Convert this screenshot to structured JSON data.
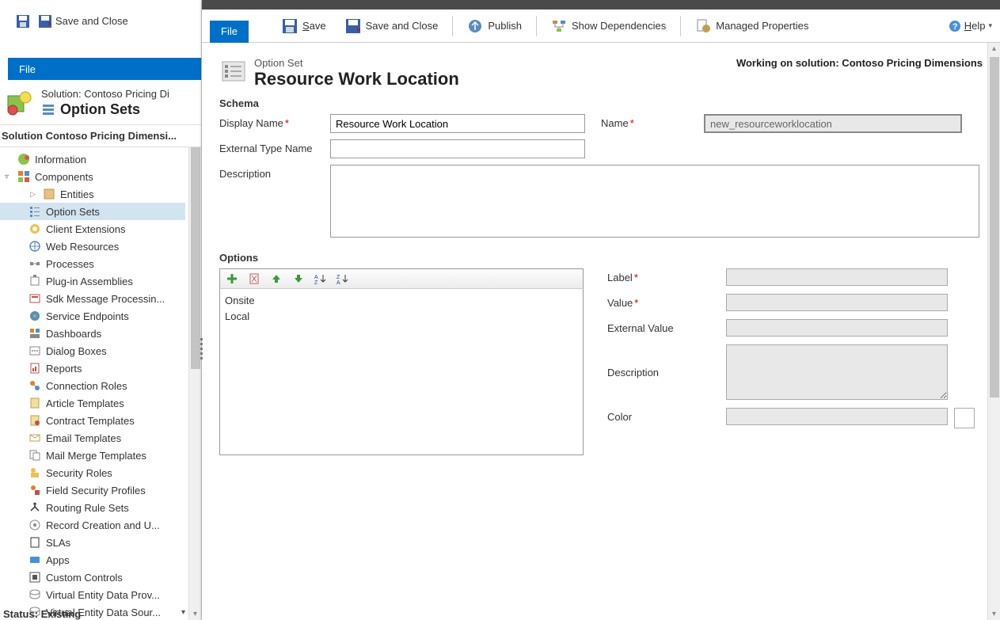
{
  "left": {
    "file_label": "File",
    "toolbar": {
      "save_close": "Save and Close"
    },
    "solution_label": "Solution: Contoso Pricing Di",
    "solution_title": "Option Sets",
    "section_title": "Solution Contoso Pricing Dimensi...",
    "tree": {
      "information": "Information",
      "components": "Components",
      "entities": "Entities",
      "option_sets": "Option Sets",
      "client_extensions": "Client Extensions",
      "web_resources": "Web Resources",
      "processes": "Processes",
      "plugin_assemblies": "Plug-in Assemblies",
      "sdk_message": "Sdk Message Processin...",
      "service_endpoints": "Service Endpoints",
      "dashboards": "Dashboards",
      "dialog_boxes": "Dialog Boxes",
      "reports": "Reports",
      "connection_roles": "Connection Roles",
      "article_templates": "Article Templates",
      "contract_templates": "Contract Templates",
      "email_templates": "Email Templates",
      "mail_merge": "Mail Merge Templates",
      "security_roles": "Security Roles",
      "field_security": "Field Security Profiles",
      "routing_rule": "Routing Rule Sets",
      "record_creation": "Record Creation and U...",
      "slas": "SLAs",
      "apps": "Apps",
      "custom_controls": "Custom Controls",
      "virtual_entity_prov": "Virtual Entity Data Prov...",
      "virtual_entity_sour": "Virtual Entity Data Sour..."
    },
    "status": "Status: Existing"
  },
  "right": {
    "file_label": "File",
    "ribbon": {
      "save": "Save",
      "save_close": "Save and Close",
      "publish": "Publish",
      "show_dependencies": "Show Dependencies",
      "managed_properties": "Managed Properties",
      "help": "Help"
    },
    "header": {
      "top": "Option Set",
      "title": "Resource Work Location",
      "working": "Working on solution: Contoso Pricing Dimensions"
    },
    "schema": {
      "section": "Schema",
      "display_name_label": "Display Name",
      "display_name_value": "Resource Work Location",
      "name_label": "Name",
      "name_value": "new_resourceworklocation",
      "external_label": "External Type Name",
      "external_value": "",
      "description_label": "Description",
      "description_value": ""
    },
    "options": {
      "section": "Options",
      "items": [
        "Onsite",
        "Local"
      ],
      "label_label": "Label",
      "value_label": "Value",
      "external_value_label": "External Value",
      "description_label": "Description",
      "color_label": "Color"
    }
  }
}
